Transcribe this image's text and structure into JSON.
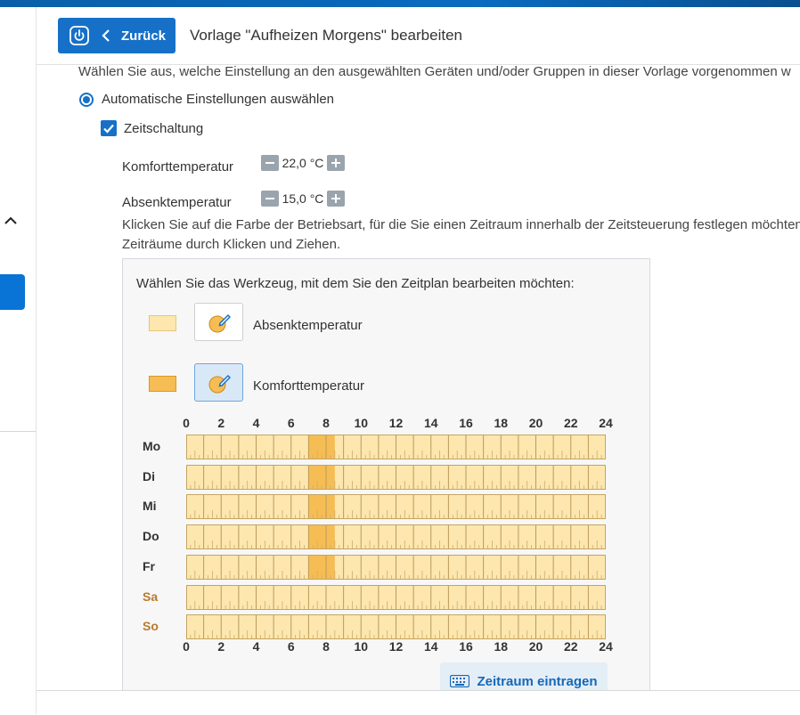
{
  "header": {
    "back_label": "Zurück",
    "title": "Vorlage \"Aufheizen Morgens\" bearbeiten"
  },
  "intro_text": "Wählen Sie aus, welche Einstellung an den ausgewählten Geräten und/oder Gruppen in dieser Vorlage vorgenommen w",
  "radio_label": "Automatische Einstellungen auswählen",
  "checkbox_label": "Zeitschaltung",
  "temps": {
    "comfort_label": "Komforttemperatur",
    "comfort_value": "22,0 °C",
    "setback_label": "Absenktemperatur",
    "setback_value": "15,0 °C"
  },
  "instructions": {
    "line1": "Klicken Sie auf die Farbe der Betriebsart, für die Sie einen Zeitraum innerhalb der Zeitsteuerung festlegen möchten.",
    "line2": "Zeiträume durch Klicken und Ziehen."
  },
  "panel": {
    "title": "Wählen Sie das Werkzeug, mit dem Sie den Zeitplan bearbeiten möchten:",
    "tool_setback_label": "Absenktemperatur",
    "tool_comfort_label": "Komforttemperatur",
    "entry_button": "Zeitraum eintragen"
  },
  "schedule": {
    "hour_ticks": [
      "0",
      "2",
      "4",
      "6",
      "8",
      "10",
      "12",
      "14",
      "16",
      "18",
      "20",
      "22",
      "24"
    ],
    "days": [
      {
        "label": "Mo",
        "weekend": false,
        "comfort": [
          [
            7,
            8.5
          ]
        ]
      },
      {
        "label": "Di",
        "weekend": false,
        "comfort": [
          [
            7,
            8.5
          ]
        ]
      },
      {
        "label": "Mi",
        "weekend": false,
        "comfort": [
          [
            7,
            8.5
          ]
        ]
      },
      {
        "label": "Do",
        "weekend": false,
        "comfort": [
          [
            7,
            8.5
          ]
        ]
      },
      {
        "label": "Fr",
        "weekend": false,
        "comfort": [
          [
            7,
            8.5
          ]
        ]
      },
      {
        "label": "Sa",
        "weekend": true,
        "comfort": []
      },
      {
        "label": "So",
        "weekend": true,
        "comfort": []
      }
    ]
  },
  "colors": {
    "primary": "#1670c8",
    "setback": "#fde7ae",
    "comfort": "#f6bd55",
    "weekday_text": "#333333",
    "weekend_text": "#b87a2c"
  }
}
